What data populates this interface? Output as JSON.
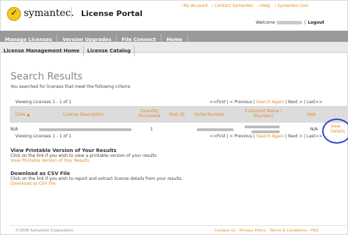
{
  "top_links": [
    "› My Account",
    "› Contact Symantec",
    "› Help",
    "› Symantec.com"
  ],
  "brand": "symantec.",
  "portal_title": "License Portal",
  "welcome": {
    "prefix": "Welcome",
    "logout": "Logout"
  },
  "main_nav": [
    "Manage Licenses",
    "Version Upgrades",
    "File Connect",
    "Home"
  ],
  "sub_nav": [
    "License Management Home",
    "License Catalog"
  ],
  "page": {
    "title": "Search Results",
    "description": "You searched for licenses that meet the following criteria"
  },
  "viewing": "Viewing Licenses 1 - 1 of 1",
  "pager": {
    "first": "<<First",
    "previous": "< Previous",
    "search_again": "Search Again",
    "next": "Next >",
    "last": "Last>>"
  },
  "table": {
    "headers": {
      "date": "Date ▲",
      "license_description": "License Description",
      "quantity": "Quantity Purchased",
      "host_id": "Host ID",
      "serial": "Serial Number",
      "customer": "Customer Name / (Number)",
      "san": "SAN"
    },
    "row": {
      "date": "N/A",
      "quantity": "1",
      "san": "N/A",
      "action": "View Details"
    }
  },
  "printable": {
    "title": "View Printable Version of Your Results",
    "text": "Click on the link if you wish to view a printable version of your results",
    "link": "View Printable Version of Your Results"
  },
  "csv": {
    "title": "Download as CSV File",
    "text": "Click on the link if you wish to report and extract license details from your results.",
    "link": "Download as CSV File"
  },
  "footer": {
    "copyright": "©2006 Symantec Corporation",
    "links": [
      "Contact Us",
      "Privacy Policy",
      "Terms & Conditions",
      "FAQ"
    ]
  },
  "colors": {
    "accent": "#e28a1f",
    "nav_bg": "#9a9a9a",
    "highlight_circle": "#2b3ed2"
  }
}
